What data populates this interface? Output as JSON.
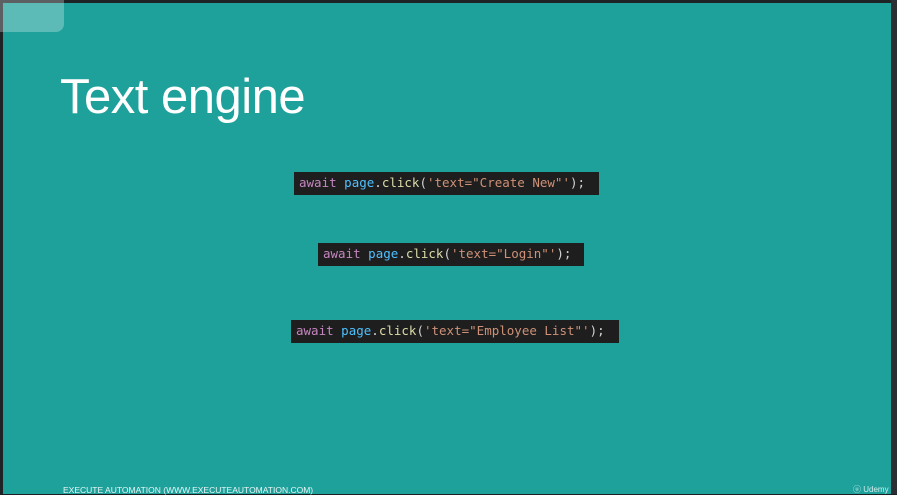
{
  "slide": {
    "title": "Text engine",
    "background_color": "#1ea19b",
    "code_lines": [
      {
        "keyword": "await",
        "object": "page",
        "dot": ".",
        "method": "click",
        "open": "(",
        "string": "'text=\"Create New\"'",
        "close": ");"
      },
      {
        "keyword": "await",
        "object": "page",
        "dot": ".",
        "method": "click",
        "open": "(",
        "string": "'text=\"Login\"'",
        "close": ");"
      },
      {
        "keyword": "await",
        "object": "page",
        "dot": ".",
        "method": "click",
        "open": "(",
        "string": "'text=\"Employee List\"'",
        "close": ");"
      }
    ],
    "footer": "EXECUTE AUTOMATION (WWW.EXECUTEAUTOMATION.COM)"
  },
  "watermark": {
    "text": "Udemy",
    "icon": "udemy-logo-icon"
  },
  "colors": {
    "keyword": "#c586c0",
    "object": "#4fc1ff",
    "method": "#dcdcaa",
    "string": "#ce9178",
    "code_bg": "#1e1e1e"
  }
}
